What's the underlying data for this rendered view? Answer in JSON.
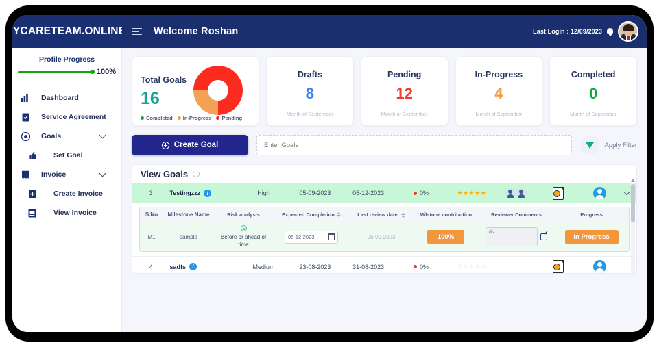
{
  "topbar": {
    "brand": "YCARETEAM.ONLINE",
    "menu_icon": "hamburger-icon",
    "welcome": "Welcome Roshan",
    "last_login": "Last Login : 12/09/2023",
    "bell_icon": "bell-icon",
    "avatar": "user-avatar"
  },
  "sidebar": {
    "progress_label": "Profile Progress",
    "progress_value": "100%",
    "progress_percent": 100,
    "items": [
      {
        "label": "Dashboard",
        "icon": "chart-bar-icon",
        "sub": false,
        "chevron": false
      },
      {
        "label": "Service Agreement",
        "icon": "document-check-icon",
        "sub": false,
        "chevron": false
      },
      {
        "label": "Goals",
        "icon": "target-icon",
        "sub": false,
        "chevron": true
      },
      {
        "label": "Set Goal",
        "icon": "thumbs-up-icon",
        "sub": true,
        "chevron": false
      },
      {
        "label": "Invoice",
        "icon": "receipt-icon",
        "sub": false,
        "chevron": true
      },
      {
        "label": "Create Invoice",
        "icon": "file-add-icon",
        "sub": true,
        "chevron": false
      },
      {
        "label": "View Invoice",
        "icon": "file-view-icon",
        "sub": true,
        "chevron": false
      }
    ]
  },
  "stats": {
    "total": {
      "title": "Total Goals",
      "value": "16",
      "legend": [
        {
          "label": "Completed",
          "color": "#12a63a"
        },
        {
          "label": "In-Progress",
          "color": "#f2a254"
        },
        {
          "label": "Pending",
          "color": "#fb2b1f"
        }
      ]
    },
    "cards": [
      {
        "title": "Drafts",
        "value": "8",
        "sub": "Month of September",
        "color": "#3b82f6"
      },
      {
        "title": "Pending",
        "value": "12",
        "sub": "Month of September",
        "color": "#ef3b2d"
      },
      {
        "title": "In-Progress",
        "value": "4",
        "sub": "Month of September",
        "color": "#f2973c"
      },
      {
        "title": "Completed",
        "value": "0",
        "sub": "Month of September",
        "color": "#12a63a"
      }
    ]
  },
  "chart_data": {
    "type": "pie",
    "title": "Total Goals",
    "categories": [
      "Completed",
      "In-Progress",
      "Pending"
    ],
    "values": [
      0,
      4,
      12
    ],
    "colors": [
      "#12a63a",
      "#f2a254",
      "#fb2b1f"
    ],
    "total": 16,
    "legend_position": "bottom"
  },
  "actions": {
    "create_label": "Create Goal",
    "create_icon": "plus-circle-icon",
    "search_placeholder": "Enter Goals",
    "search_value": "",
    "filter_label": "Apply Filter",
    "filter_icon": "funnel-icon"
  },
  "panel": {
    "title": "View Goals",
    "refresh_icon": "refresh-icon"
  },
  "goals": [
    {
      "sno": "3",
      "name": "Testingzzz",
      "priority": "High",
      "start_date": "05-09-2023",
      "end_date": "05-12-2023",
      "progress": "0%",
      "stars_filled": 5,
      "expanded": true
    },
    {
      "sno": "4",
      "name": "sadfs",
      "priority": "Medium",
      "start_date": "23-08-2023",
      "end_date": "31-08-2023",
      "progress": "0%",
      "stars_filled": 0,
      "expanded": false
    }
  ],
  "milestone_table": {
    "headers": [
      "S.No",
      "Milestone Name",
      "Risk analysis",
      "Expected Completion",
      "Last review date",
      "Milstone contribution",
      "Reviewer Comments",
      "Progress"
    ],
    "row": {
      "sno": "M1",
      "name": "sample",
      "risk": "Before or ahead of time",
      "expected_completion": "05-12-2023",
      "last_review_date": "06-09-2023",
      "contribution": "100%",
      "comment_placeholder": "ds",
      "comment_value": "",
      "progress_label": "In Progress"
    }
  }
}
